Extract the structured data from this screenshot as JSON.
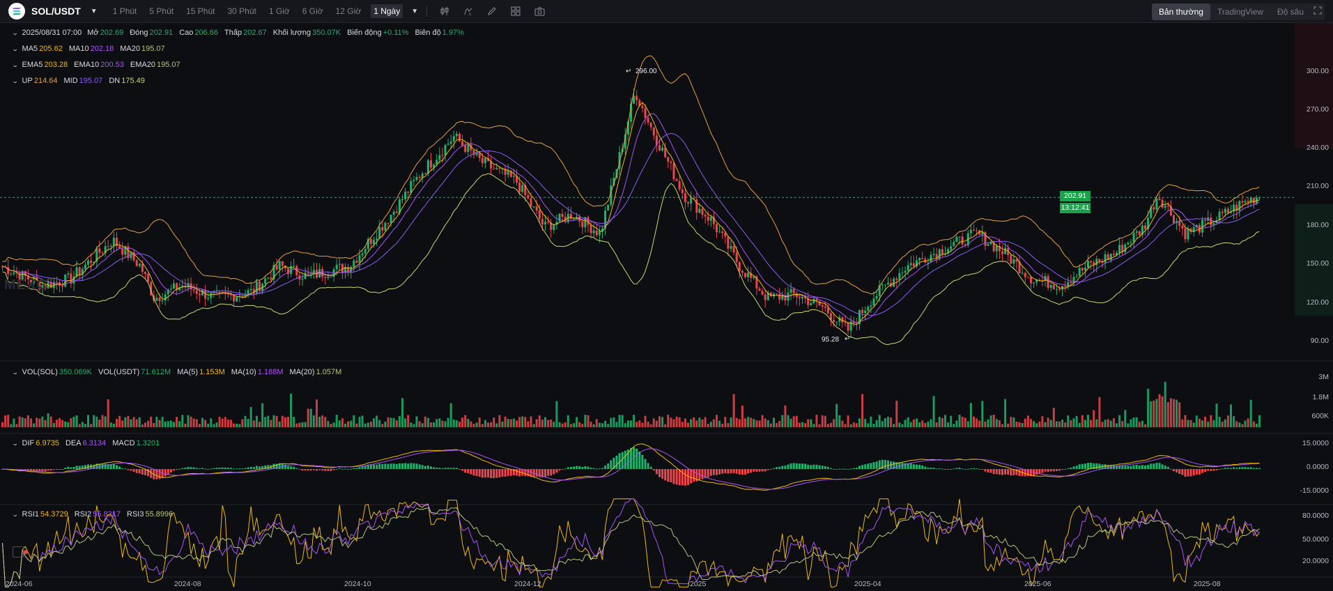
{
  "header": {
    "pair": "SOL/USDT",
    "timeframes": [
      "1 Phút",
      "5 Phút",
      "15 Phút",
      "30 Phút",
      "1 Giờ",
      "6 Giờ",
      "12 Giờ",
      "1 Ngày"
    ],
    "active_timeframe": "1 Ngày",
    "view_tabs": [
      "Bản thường",
      "TradingView",
      "Độ sâu"
    ],
    "active_view": "Bản thường"
  },
  "ohlc": {
    "date": "2025/08/31 07:00",
    "open_label": "Mở",
    "open": "202.69",
    "close_label": "Đóng",
    "close": "202.91",
    "high_label": "Cao",
    "high": "206.66",
    "low_label": "Thấp",
    "low": "202.67",
    "vol_label": "Khối lượng",
    "vol": "350.07K",
    "change_label": "Biến động",
    "change": "+0.11%",
    "amp_label": "Biên độ",
    "amp": "1.97%"
  },
  "ma": {
    "ma5_label": "MA5",
    "ma5": "205.62",
    "ma10_label": "MA10",
    "ma10": "202.18",
    "ma20_label": "MA20",
    "ma20": "195.07"
  },
  "ema": {
    "ema5_label": "EMA5",
    "ema5": "203.28",
    "ema10_label": "EMA10",
    "ema10": "200.53",
    "ema20_label": "EMA20",
    "ema20": "195.07"
  },
  "boll": {
    "up_label": "UP",
    "up": "214.64",
    "mid_label": "MID",
    "mid": "195.07",
    "dn_label": "DN",
    "dn": "175.49"
  },
  "volume": {
    "vol_sol_label": "VOL(SOL)",
    "vol_sol": "350.069K",
    "vol_usdt_label": "VOL(USDT)",
    "vol_usdt": "71.612M",
    "ma5_label": "MA(5)",
    "ma5": "1.153M",
    "ma10_label": "MA(10)",
    "ma10": "1.188M",
    "ma20_label": "MA(20)",
    "ma20": "1.057M"
  },
  "macd": {
    "dif_label": "DIF",
    "dif": "6.9735",
    "dea_label": "DEA",
    "dea": "6.3134",
    "macd_label": "MACD",
    "macd": "1.3201"
  },
  "rsi": {
    "rsi1_label": "RSI1",
    "rsi1": "54.3729",
    "rsi2_label": "RSI2",
    "rsi2": "55.8317",
    "rsi3_label": "RSI3",
    "rsi3": "55.8996"
  },
  "annotations": {
    "high": "296.00",
    "low": "95.28"
  },
  "price_axis": [
    "300.00",
    "270.00",
    "240.00",
    "210.00",
    "180.00",
    "150.00",
    "120.00",
    "90.00"
  ],
  "vol_axis": [
    "3M",
    "1.8M",
    "600K"
  ],
  "macd_axis": [
    "15.0000",
    "0.0000",
    "-15.0000"
  ],
  "rsi_axis": [
    "80.0000",
    "50.0000",
    "20.0000"
  ],
  "current_price": "202.91",
  "countdown": "13:12:41",
  "time_axis": [
    "2024-06",
    "2024-08",
    "2024-10",
    "2024-12",
    "2025",
    "2025-04",
    "2025-06",
    "2025-08"
  ],
  "watermark": "MEXC",
  "colors": {
    "up": "#20b26c",
    "down": "#ef454a",
    "ma5": "#f0b90b",
    "ma10": "#a855f7",
    "ma20": "#b8c47a",
    "boll_up": "#e6a23c",
    "boll_dn": "#c8d86a",
    "mid": "#8b5cf6"
  },
  "chart_data": {
    "type": "candlestick",
    "series": [
      {
        "name": "SOL/USDT",
        "x": [
          "2024-06",
          "2024-07",
          "2024-08",
          "2024-09",
          "2024-10",
          "2024-11",
          "2024-12",
          "2025-01",
          "2025-02",
          "2025-03",
          "2025-04",
          "2025-05",
          "2025-06",
          "2025-07",
          "2025-08"
        ],
        "values": [
          145,
          170,
          145,
          135,
          155,
          240,
          200,
          260,
          175,
          130,
          115,
          170,
          150,
          165,
          202.91
        ]
      }
    ],
    "ylim": [
      85,
      320
    ],
    "high": 296.0,
    "low": 95.28
  }
}
